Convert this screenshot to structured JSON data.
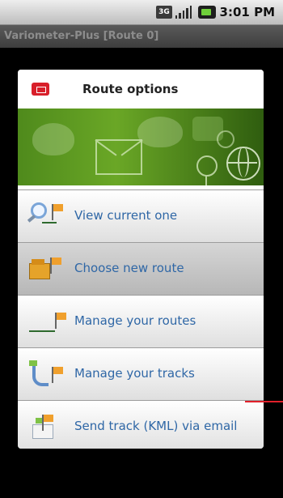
{
  "status_bar": {
    "network_label": "3G",
    "time": "3:01 PM",
    "icons": [
      "network-3g-icon",
      "signal-strength-icon",
      "battery-icon"
    ]
  },
  "app": {
    "title": "Variometer-Plus [Route 0]"
  },
  "dialog": {
    "title": "Route options",
    "header_icon": "exit-icon",
    "banner_icons": [
      "envelope-icon",
      "female-symbol-icon",
      "globe-icon",
      "male-symbol-icon",
      "phone-icon",
      "butterfly-icon"
    ],
    "items": [
      {
        "label": "View current one",
        "icon": "magnifier-route-icon",
        "selected": false
      },
      {
        "label": "Choose new route",
        "icon": "folder-route-icon",
        "selected": true
      },
      {
        "label": "Manage your routes",
        "icon": "route-flag-icon",
        "selected": false
      },
      {
        "label": "Manage your tracks",
        "icon": "track-flag-icon",
        "selected": false
      },
      {
        "label": "Send track (KML) via email",
        "icon": "email-track-icon",
        "selected": false
      }
    ]
  },
  "colors": {
    "item_text": "#2f67a6",
    "selected_bg": "#c8c8c8",
    "banner_green": "#5f9b22",
    "header_icon_red": "#d81f2a",
    "annotation_red": "#e0202a"
  }
}
